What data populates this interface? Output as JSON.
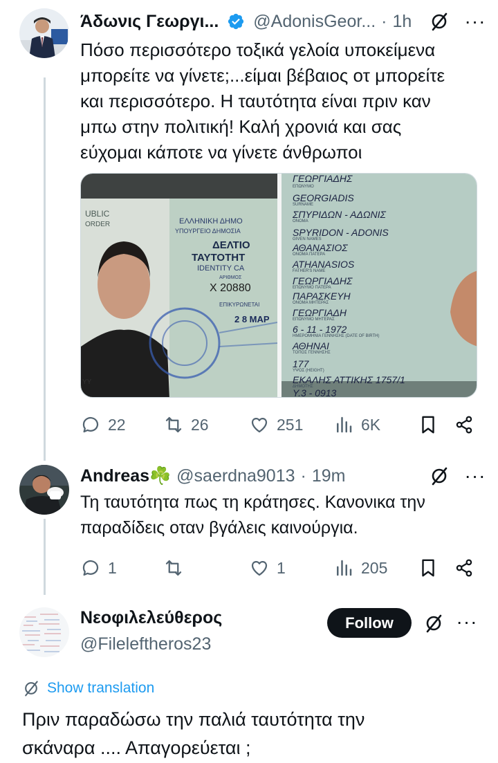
{
  "tweet1": {
    "author_name": "Άδωνις Γεωργι...",
    "verified": true,
    "handle": "@AdonisGeor...",
    "separator": "·",
    "time": "1h",
    "text_lines": [
      "Πόσο περισσότερο τοξικά γελοία υποκείμενα",
      "μπορείτε να γίνετε;...είμαι βέβαιος οτ μπορείτε",
      "και περισσότερο. Η ταυτότητα είναι πριν καν",
      "μπω στην πολιτική! Καλή χρονιά και σας",
      "εύχομαι κάποτε να γίνετε άνθρωποι"
    ],
    "media_alt": "Greek identity card photos",
    "card_left_texts": [
      "UBLIC",
      "ORDER",
      "ΕΛΛΗΝΙΚΗ ΔΗΜΟ",
      "ΥΠΟΥΡΓΕΙΟ ΔΗΜΟΣΙΑ",
      "ΔΕΛΤΙΟ",
      "ΤΑΥΤΟΤΗΤ",
      "IDENTITY CA",
      "ΑΡΙΘΜΟΣ",
      "Χ 20880",
      "ΕΠΙΚΥΡΩΝΕΤΑΙ",
      "2 8 ΜΑΡ",
      "ΥΥ"
    ],
    "card_right_texts": [
      "ΓΕΩΡΓΙΑΔΗΣ",
      "ΕΠΩΝΥΜΟ",
      "GEORGIADIS",
      "SURNAME",
      "ΣΠΥΡΙΔΩΝ - ΑΔΩΝΙΣ",
      "ΟΝΟΜΑ",
      "SPYRIDON - ADONIS",
      "GIVEN NAMES",
      "ΑΘΑΝΑΣΙΟΣ",
      "ΟΝΟΜΑ ΠΑΤΕΡΑ",
      "ATHANASIOS",
      "FATHER'S NAME",
      "ΓΕΩΡΓΙΑΔΗΣ",
      "ΕΠΩΝΥΜΟ ΠΑΤΕΡΑ",
      "ΠΑΡΑΣΚΕΥΗ",
      "ΟΝΟΜΑ ΜΗΤΕΡΑΣ",
      "ΓΕΩΡΓΙΑΔΗ",
      "ΕΠΩΝΥΜΟ ΜΗΤΕΡΑΣ",
      "6 - 11 - 1972",
      "ΗΜΕΡΟΜΗΝΙΑ ΓΕΝΝΗΣΗΣ (DATE OF BIRTH)",
      "ΑΘΗΝΑΙ",
      "ΤΟΠΟΣ ΓΕΝΝΗΣΗΣ",
      "177",
      "ΥΨΟΣ (HEIGHT)",
      "ΕΚΑΛΗΣ ΑΤΤΙΚΗΣ 1757/1",
      "ΔΗΜΟΤΗΣ",
      "Υ.3 - 0913"
    ],
    "stats": {
      "replies": "22",
      "reposts": "26",
      "likes": "251",
      "views": "6K"
    }
  },
  "tweet2": {
    "author_name": "Andreas☘️",
    "handle": "@saerdna9013",
    "separator": "·",
    "time": "19m",
    "text_lines": [
      "Τη ταυτότητα πως τη κράτησες. Κανονικα την",
      "παραδίδεις οταν βγάλεις καινούργια."
    ],
    "stats": {
      "replies": "1",
      "reposts": "",
      "likes": "1",
      "views": "205"
    }
  },
  "tweet3": {
    "author_name": "Νεοφιλελεύθερος",
    "handle": "@Fileleftheros23",
    "follow_label": "Follow",
    "translate_label": "Show translation",
    "text_lines": [
      "Πριν παραδώσω την παλιά ταυτότητα την",
      "σκάναρα .... Απαγορεύεται ;"
    ]
  },
  "colors": {
    "text": "#0f1419",
    "muted": "#536471",
    "accent": "#1d9bf0",
    "verified": "#1d9bf0"
  }
}
